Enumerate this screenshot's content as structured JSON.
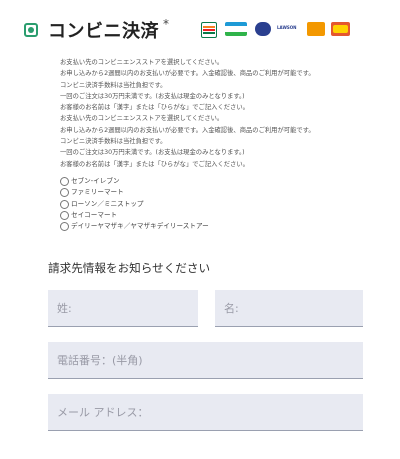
{
  "payment": {
    "title": "コンビニ決済",
    "required_mark": "*",
    "logo_lawson_text": "LAWSON",
    "notes": [
      "お支払い先のコンビニエンスストアを選択してください。",
      "お申し込みから2週間以内のお支払いが必要です。入金確認後、商品のご利用が可能です。",
      "コンビニ決済手数料は当社負担です。",
      "一回のご注文は30万円未満です。(お支払は現金のみとなります。)",
      "お客様のお名前は「漢字」または「ひらがな」でご記入ください。",
      "お支払い先のコンビニエンスストアを選択してください。",
      "お申し込みから2週間以内のお支払いが必要です。入金確認後、商品のご利用が可能です。",
      "コンビニ決済手数料は当社負担です。",
      "一回のご注文は30万円未満です。(お支払は現金のみとなります。)",
      "お客様のお名前は「漢字」または「ひらがな」でご記入ください。"
    ],
    "stores": [
      "セブン-イレブン",
      "ファミリーマート",
      "ローソン／ミニストップ",
      "セイコーマート",
      "デイリーヤマザキ／ヤマザキデイリーストアー"
    ]
  },
  "billing": {
    "section_title": "請求先情報をお知らせください",
    "last_name_placeholder": "姓:",
    "first_name_placeholder": "名:",
    "phone_placeholder": "電話番号：(半角)",
    "email_placeholder": "メール アドレス："
  },
  "colors": {
    "accent_green": "#2a9d6e",
    "field_bg": "#e8eaf2",
    "placeholder": "#999aa6"
  }
}
